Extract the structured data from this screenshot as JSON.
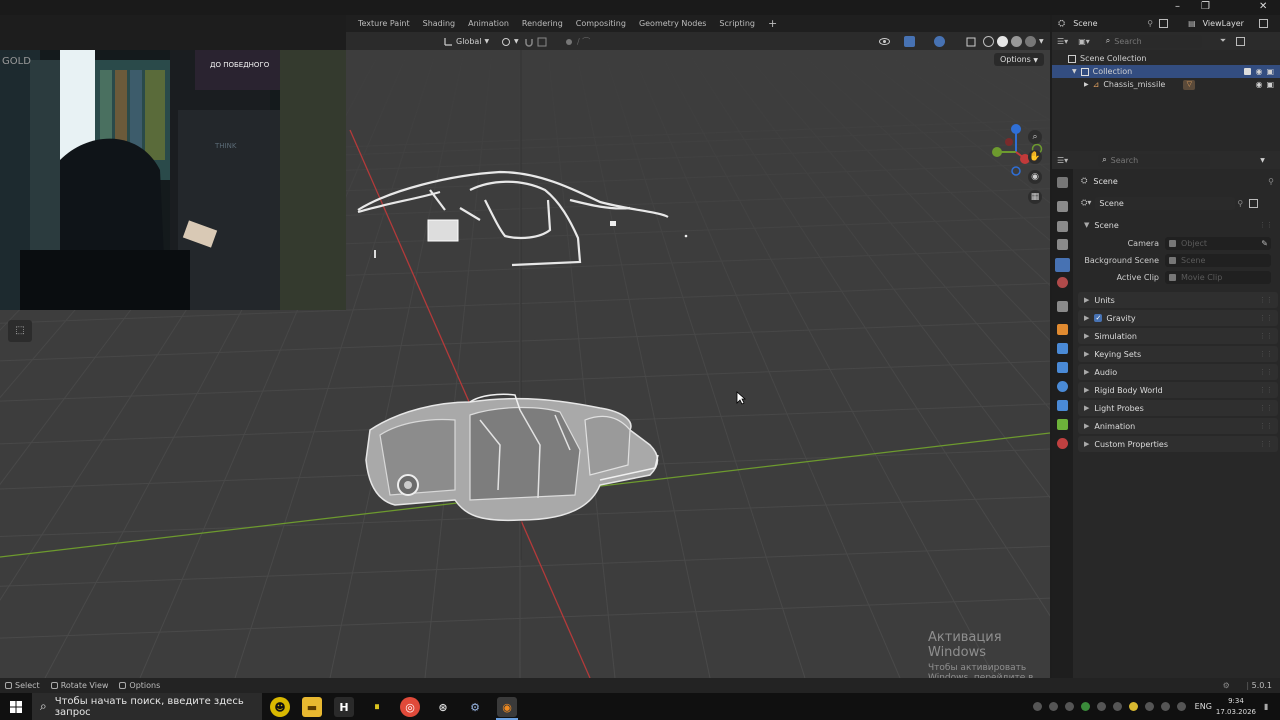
{
  "window": {
    "min": "–",
    "max": "❐",
    "close": "✕"
  },
  "workspace_tabs": [
    "Texture Paint",
    "Shading",
    "Animation",
    "Rendering",
    "Compositing",
    "Geometry Nodes",
    "Scripting"
  ],
  "workspace_add": "+",
  "viewport_header": {
    "orientation": "Global",
    "options": "Options"
  },
  "scene_header": {
    "scene_name": "Scene",
    "view_layer": "ViewLayer"
  },
  "outliner": {
    "search_placeholder": "Search",
    "root": "Scene Collection",
    "collection": "Collection",
    "object": "Chassis_missile"
  },
  "properties": {
    "search_placeholder": "Search",
    "context_title": "Scene",
    "scene_field": "Scene",
    "section_scene": "Scene",
    "fields": [
      {
        "label": "Camera",
        "placeholder": "Object"
      },
      {
        "label": "Background Scene",
        "placeholder": "Scene"
      },
      {
        "label": "Active Clip",
        "placeholder": "Movie Clip"
      }
    ],
    "panels": [
      "Units",
      "Gravity",
      "Simulation",
      "Keying Sets",
      "Audio",
      "Rigid Body World",
      "Light Probes",
      "Animation",
      "Custom Properties"
    ],
    "gravity_checked": true
  },
  "statusbar": {
    "select": "Select",
    "rotate": "Rotate View",
    "options": "Options",
    "version": "5.0.1"
  },
  "watermark": {
    "title": "Активация Windows",
    "subtitle": "Чтобы активировать Windows, перейдите в раздел \"Параметры\"."
  },
  "taskbar": {
    "search_placeholder": "Чтобы начать поиск, введите здесь запрос",
    "lang": "ENG",
    "time": "9:34",
    "date": "17.03.2026"
  },
  "webcam": {
    "sign_text": "ДО ПОБЕДНОГО",
    "gold": "GOLD",
    "poster": "THINK"
  },
  "colors": {
    "axis_x": "#b33a3a",
    "axis_y": "#6d9a2e",
    "accent": "#4772b3",
    "viewport_bg": "#3d3d3d"
  }
}
